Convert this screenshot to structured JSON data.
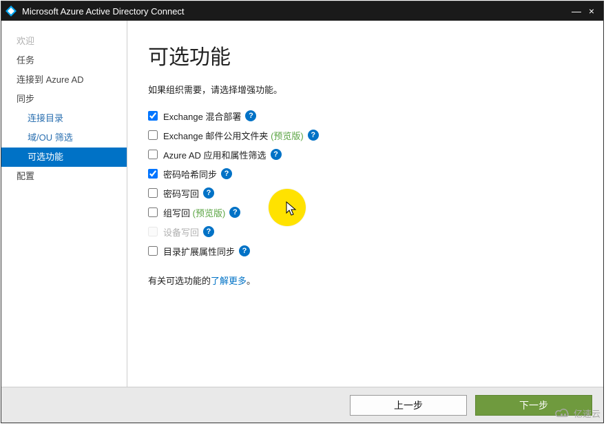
{
  "window": {
    "title": "Microsoft Azure Active Directory Connect"
  },
  "sidebar": {
    "items": [
      {
        "label": "欢迎",
        "state": "disabled"
      },
      {
        "label": "任务"
      },
      {
        "label": "连接到 Azure AD"
      },
      {
        "label": "同步"
      },
      {
        "label": "连接目录",
        "sub": true
      },
      {
        "label": "域/OU 筛选",
        "sub": true
      },
      {
        "label": "可选功能",
        "sub": true,
        "state": "active"
      },
      {
        "label": "配置"
      }
    ]
  },
  "main": {
    "heading": "可选功能",
    "subtitle": "如果组织需要，请选择增强功能。",
    "options": [
      {
        "id": "exchange-hybrid",
        "label": "Exchange 混合部署",
        "checked": true
      },
      {
        "id": "exchange-pf",
        "label": "Exchange 邮件公用文件夹",
        "preview": "(预览版)",
        "checked": false
      },
      {
        "id": "aad-app-attr",
        "label": "Azure AD 应用和属性筛选",
        "checked": false
      },
      {
        "id": "password-hash-sync",
        "label": "密码哈希同步",
        "checked": true
      },
      {
        "id": "password-writeback",
        "label": "密码写回",
        "checked": false
      },
      {
        "id": "group-writeback",
        "label": "组写回",
        "preview": "(预览版)",
        "checked": false
      },
      {
        "id": "device-writeback",
        "label": "设备写回",
        "checked": false,
        "disabled": true
      },
      {
        "id": "dir-ext-attr-sync",
        "label": "目录扩展属性同步",
        "checked": false
      }
    ],
    "learn_prefix": "有关可选功能的",
    "learn_link": "了解更多",
    "learn_suffix": "。"
  },
  "footer": {
    "previous": "上一步",
    "next": "下一步"
  },
  "watermark": "亿速云",
  "help_glyph": "?"
}
